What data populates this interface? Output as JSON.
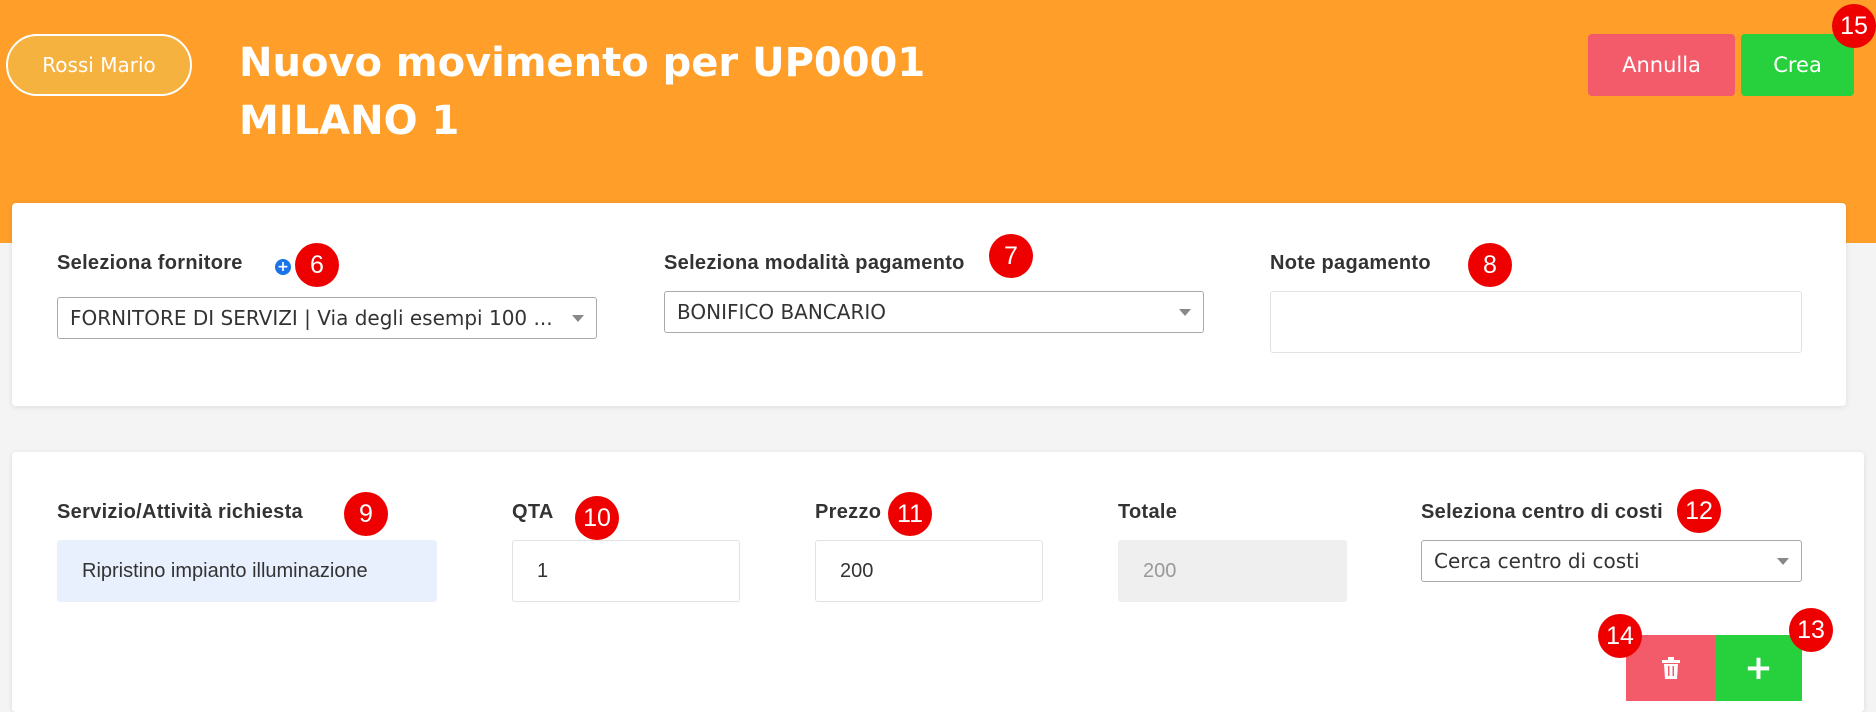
{
  "header": {
    "user_label": "Rossi Mario",
    "title": "Nuovo movimento per UP0001 MILANO 1",
    "cancel_label": "Annulla",
    "create_label": "Crea"
  },
  "payment": {
    "supplier_label": "Seleziona fornitore",
    "supplier_value": "FORNITORE DI SERVIZI | Via degli esempi 100 ...",
    "method_label": "Seleziona modalità pagamento",
    "method_value": "BONIFICO BANCARIO",
    "notes_label": "Note pagamento",
    "notes_value": ""
  },
  "line_item": {
    "service_label": "Servizio/Attività richiesta",
    "service_value": "Ripristino impianto illuminazione",
    "qty_label": "QTA",
    "qty_value": "1",
    "price_label": "Prezzo",
    "price_value": "200",
    "total_label": "Totale",
    "total_value": "200",
    "cost_center_label": "Seleziona centro di costi",
    "cost_center_placeholder": "Cerca centro di costi",
    "add_symbol": "+"
  },
  "badges": [
    "6",
    "7",
    "8",
    "9",
    "10",
    "11",
    "12",
    "13",
    "14",
    "15"
  ],
  "icons": {
    "add_supplier": "plus-circle-icon",
    "delete": "trash-icon"
  },
  "colors": {
    "header": "#ff9f2a",
    "cancel": "#f45b6a",
    "create": "#27d13d",
    "badge": "#ee0000"
  }
}
